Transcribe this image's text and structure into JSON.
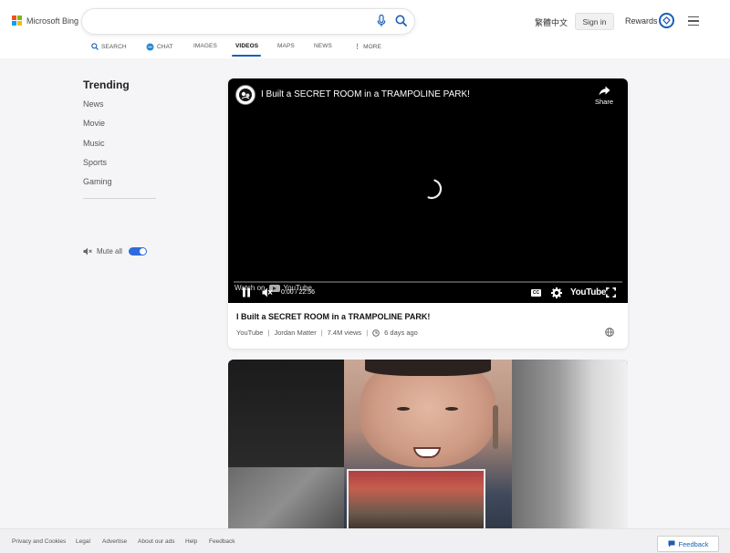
{
  "header": {
    "brand": "Microsoft Bing",
    "search": {
      "value": "",
      "placeholder": ""
    },
    "language_link": "繁體中文",
    "signin_label": "Sign in",
    "rewards_label": "Rewards"
  },
  "nav": {
    "items": [
      {
        "label": "SEARCH",
        "icon": "search-icon"
      },
      {
        "label": "CHAT",
        "icon": "chat-icon"
      },
      {
        "label": "IMAGES"
      },
      {
        "label": "VIDEOS",
        "active": true
      },
      {
        "label": "MAPS"
      },
      {
        "label": "NEWS"
      },
      {
        "label": "MORE",
        "icon": "more-vertical-icon"
      }
    ]
  },
  "sidebar": {
    "title": "Trending",
    "categories": [
      "News",
      "Movie",
      "Music",
      "Sports",
      "Gaming"
    ],
    "mute_label": "Mute all",
    "mute_on": true
  },
  "video": {
    "player_title": "I Built a SECRET ROOM in a TRAMPOLINE PARK!",
    "share_label": "Share",
    "watch_on": "Watch on",
    "youtube_small": "YouTube",
    "time": "0:00 / 22:56",
    "cc_label": "CC",
    "youtube_logo": "YouTube",
    "title": "I Built a SECRET ROOM in a TRAMPOLINE PARK!",
    "source": "YouTube",
    "channel": "Jordan Matter",
    "views": "7.4M views",
    "age": "6 days ago"
  },
  "footer": {
    "links": [
      "Privacy and Cookies",
      "Legal",
      "Advertise",
      "About our ads",
      "Help",
      "Feedback"
    ],
    "feedback_button": "Feedback"
  },
  "colors": {
    "accent": "#1a5fb4",
    "toggle_on": "#2e6bdc"
  }
}
